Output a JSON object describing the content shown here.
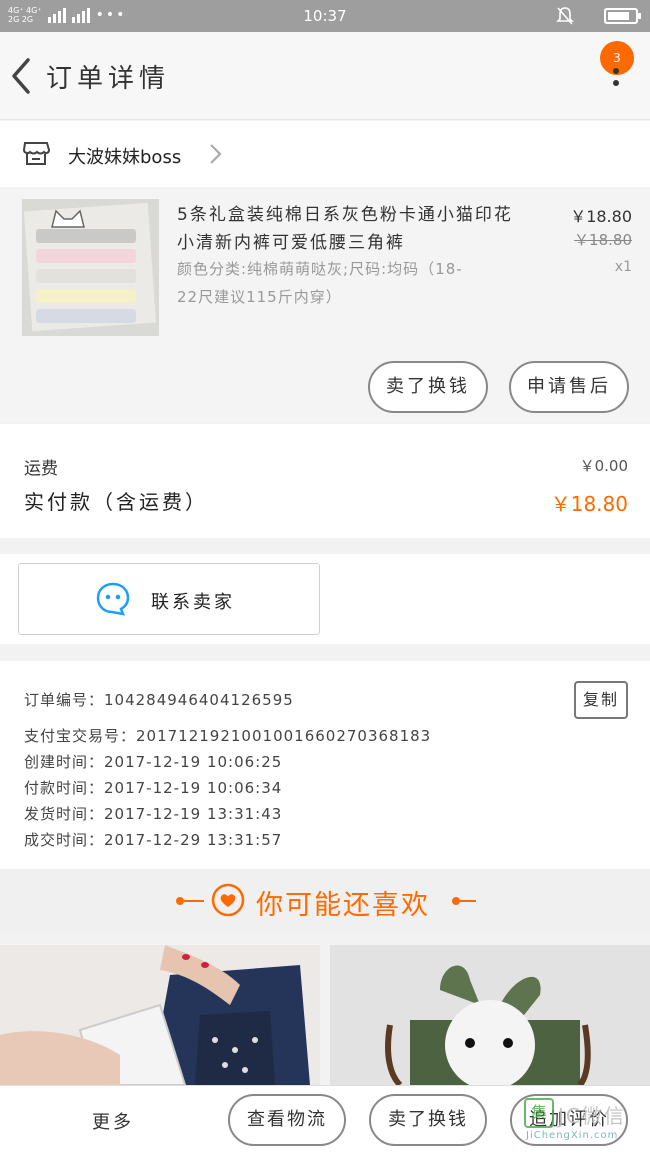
{
  "status_bar": {
    "network_labels": [
      "4G⁺ 4G⁺",
      "2G 2G"
    ],
    "dots": "•••",
    "time": "10:37"
  },
  "header": {
    "title": "订单详情",
    "message_badge": "3"
  },
  "shop": {
    "name": "大波妹妹boss"
  },
  "product": {
    "title": "5条礼盒装纯棉日系灰色粉卡通小猫印花小清新内裤可爱低腰三角裤",
    "sku": "颜色分类:纯棉萌萌哒灰;尺码:均码（18-22尺建议115斤内穿）",
    "price_now": "￥18.80",
    "price_old": "￥18.80",
    "quantity": "x1",
    "actions": [
      "卖了换钱",
      "申请售后"
    ]
  },
  "fee": {
    "shipping_label": "运费",
    "shipping_value": "￥0.00",
    "paid_label": "实付款（含运费）",
    "paid_value": "￥18.80"
  },
  "contact": {
    "label": "联系卖家"
  },
  "order_info": {
    "lines": [
      "订单编号：104284946404126595",
      "支付宝交易号：2017121921001001660270368183",
      "创建时间：2017-12-19  10:06:25",
      "付款时间：2017-12-19  10:06:34",
      "发货时间：2017-12-19  13:31:43",
      "成交时间：2017-12-29  13:31:57"
    ],
    "copy_label": "复制"
  },
  "recommend": {
    "title": "你可能还喜欢"
  },
  "bottom_bar": {
    "more": "更多",
    "buttons": [
      "查看物流",
      "卖了换钱",
      "追加评价"
    ]
  },
  "watermark": {
    "mark": "集",
    "cn": "JC微信",
    "en": "JiChengXin.com"
  },
  "colors": {
    "accent": "#ff6a00",
    "status_bar": "#9e9e9e"
  }
}
